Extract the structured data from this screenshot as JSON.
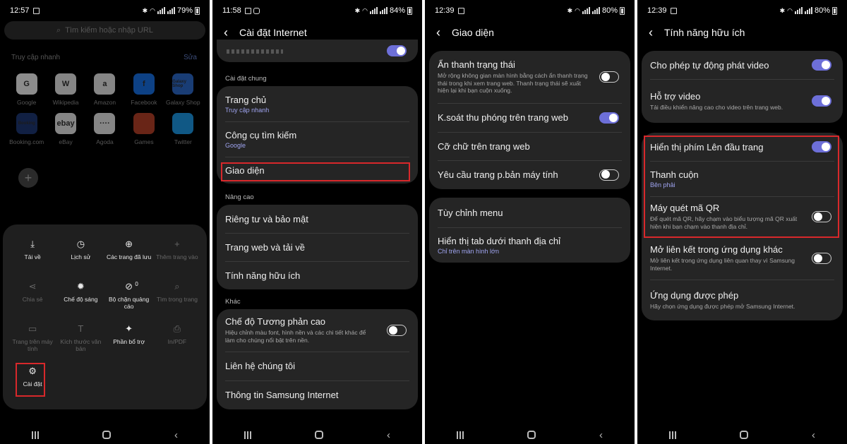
{
  "panel1": {
    "status": {
      "time": "12:57",
      "battery": "79%"
    },
    "search_placeholder": "Tìm kiếm hoặc nhập URL",
    "quick_access": {
      "title": "Truy cập nhanh",
      "edit": "Sửa",
      "items": [
        {
          "label": "Google",
          "icon": "google-logo",
          "color": "#ffffff",
          "abbr": "G"
        },
        {
          "label": "Wikipedia",
          "icon": "wikipedia-logo",
          "color": "#f2f2f2",
          "abbr": "W"
        },
        {
          "label": "Amazon",
          "icon": "amazon-logo",
          "color": "#f2f2f2",
          "abbr": "a"
        },
        {
          "label": "Facebook",
          "icon": "facebook-logo",
          "color": "#1877f2",
          "abbr": "f"
        },
        {
          "label": "Galaxy Shop",
          "icon": "galaxy-shop-logo",
          "color": "#2f6fd6",
          "abbr": "Galaxy Shop"
        },
        {
          "label": "Booking.com",
          "icon": "booking-logo",
          "color": "#1f3b7a",
          "abbr": "Booking"
        },
        {
          "label": "eBay",
          "icon": "ebay-logo",
          "color": "#f2f2f2",
          "abbr": "ebay"
        },
        {
          "label": "Agoda",
          "icon": "agoda-logo",
          "color": "#f2f2f2",
          "abbr": "····"
        },
        {
          "label": "Games",
          "icon": "games-logo",
          "color": "#c0442a",
          "abbr": ""
        },
        {
          "label": "Twitter",
          "icon": "twitter-logo",
          "color": "#1da1f2",
          "abbr": ""
        }
      ]
    },
    "menu": [
      {
        "label": "Tải về",
        "icon": "download-icon",
        "glyph": "⤓",
        "dim": false
      },
      {
        "label": "Lịch sử",
        "icon": "history-icon",
        "glyph": "◷",
        "dim": false
      },
      {
        "label": "Các trang đã lưu",
        "icon": "saved-pages-icon",
        "glyph": "⊕",
        "dim": false
      },
      {
        "label": "Thêm trang vào",
        "icon": "add-page-icon",
        "glyph": "+",
        "dim": true
      },
      {
        "label": "Chia sẻ",
        "icon": "share-icon",
        "glyph": "⋖",
        "dim": true
      },
      {
        "label": "Chế độ sáng",
        "icon": "brightness-icon",
        "glyph": "✹",
        "dim": false
      },
      {
        "label": "Bộ chặn quảng cáo",
        "icon": "ad-block-icon",
        "glyph": "⊘",
        "badge": "0",
        "dim": false
      },
      {
        "label": "Tìm trong trang",
        "icon": "find-in-page-icon",
        "glyph": "⌕",
        "dim": true
      },
      {
        "label": "Trang trên máy tính",
        "icon": "desktop-icon",
        "glyph": "▭",
        "dim": true
      },
      {
        "label": "Kích thước văn bản",
        "icon": "text-size-icon",
        "glyph": "T",
        "dim": true
      },
      {
        "label": "Phần bổ trợ",
        "icon": "add-ons-icon",
        "glyph": "✦",
        "dim": false
      },
      {
        "label": "In/PDF",
        "icon": "print-icon",
        "glyph": "⎙",
        "dim": true
      },
      {
        "label": "Cài đặt",
        "icon": "settings-icon",
        "glyph": "⚙",
        "dim": false
      }
    ]
  },
  "panel2": {
    "status": {
      "time": "11:58",
      "battery": "84%"
    },
    "title": "Cài đặt Internet",
    "section_general": "Cài đặt chung",
    "general": [
      {
        "title": "Trang chủ",
        "sub": "Truy cập nhanh"
      },
      {
        "title": "Công cụ tìm kiếm",
        "sub": "Google"
      },
      {
        "title": "Giao diện"
      }
    ],
    "section_advanced": "Nâng cao",
    "advanced": [
      {
        "title": "Riêng tư và bảo mật"
      },
      {
        "title": "Trang web và tải về"
      },
      {
        "title": "Tính năng hữu ích"
      }
    ],
    "section_other": "Khác",
    "other": [
      {
        "title": "Chế độ Tương phản cao",
        "desc": "Hiệu chỉnh màu font, hình nền và các chi tiết khác để làm cho chúng nổi bật trên nền.",
        "toggle": "off"
      },
      {
        "title": "Liên hệ chúng tôi"
      },
      {
        "title": "Thông tin Samsung Internet"
      }
    ]
  },
  "panel3": {
    "status": {
      "time": "12:39",
      "battery": "80%"
    },
    "title": "Giao diện",
    "card1": [
      {
        "title": "Ẩn thanh trạng thái",
        "desc": "Mở rộng không gian màn hình bằng cách ẩn thanh trạng thái trong khi xem trang web. Thanh trạng thái sẽ xuất hiện lại khi bạn cuộn xuống.",
        "toggle": "off"
      },
      {
        "title": "K.soát thu phóng trên trang web",
        "toggle": "on"
      },
      {
        "title": "Cỡ chữ trên trang web"
      },
      {
        "title": "Yêu cầu trang p.bản máy tính",
        "toggle": "off"
      }
    ],
    "card2": [
      {
        "title": "Tùy chỉnh menu"
      },
      {
        "title": "Hiển thị tab dưới thanh địa chỉ",
        "sub": "Chỉ trên màn hình lớn"
      }
    ]
  },
  "panel4": {
    "status": {
      "time": "12:39",
      "battery": "80%"
    },
    "title": "Tính năng hữu ích",
    "card1": [
      {
        "title": "Cho phép tự động phát video",
        "toggle": "on"
      },
      {
        "title": "Hỗ trợ video",
        "desc": "Tải điều khiển nâng cao cho video trên trang web.",
        "toggle": "on"
      }
    ],
    "card2": [
      {
        "title": "Hiển thị phím Lên đầu trang",
        "toggle": "on"
      },
      {
        "title": "Thanh cuộn",
        "sub": "Bên phải"
      },
      {
        "title": "Máy quét mã QR",
        "desc": "Để quét mã QR, hãy chạm vào biểu tượng mã QR xuất hiện khi bạn chạm vào thanh địa chỉ.",
        "toggle": "off"
      },
      {
        "title": "Mở liên kết trong ứng dụng khác",
        "desc": "Mở liên kết trong ứng dụng liên quan thay vì Samsung Internet.",
        "toggle": "off"
      },
      {
        "title": "Ứng dụng được phép",
        "desc": "Hãy chọn ứng dụng được phép mở Samsung Internet."
      }
    ]
  }
}
